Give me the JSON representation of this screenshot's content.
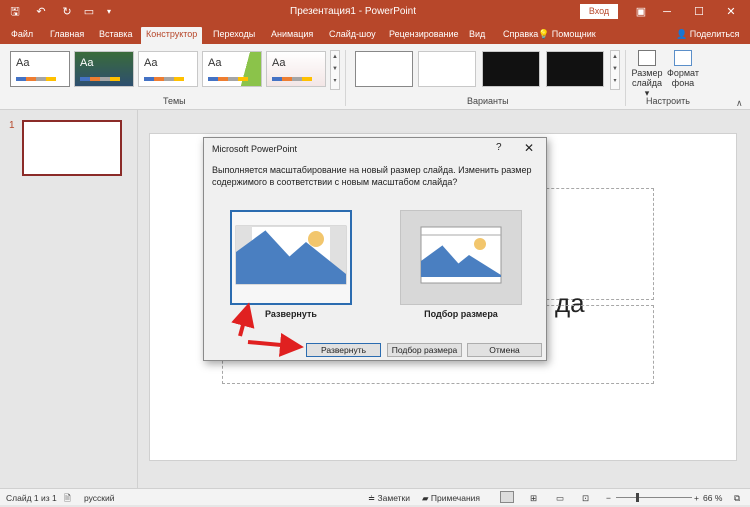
{
  "app": {
    "title": "Презентация1  -  PowerPoint",
    "login": "Вход"
  },
  "quick_access": {
    "save_icon": "save-icon",
    "undo_icon": "undo-icon",
    "redo_icon": "redo-icon",
    "present_icon": "present-from-start-icon"
  },
  "tabs": [
    "Файл",
    "Главная",
    "Вставка",
    "Конструктор",
    "Переходы",
    "Анимация",
    "Слайд-шоу",
    "Рецензирование",
    "Вид",
    "Справка"
  ],
  "active_tab": "Конструктор",
  "help": {
    "label": "Помощник"
  },
  "share": {
    "label": "Поделиться"
  },
  "ribbon": {
    "themes_label": "Темы",
    "variants_label": "Варианты",
    "customize_label": "Настроить",
    "theme_sample": "Aa",
    "slide_size": "Размер слайда",
    "slide_size_line1": "Размер",
    "slide_size_line2": "слайда ▾",
    "format_bg_line1": "Формат",
    "format_bg_line2": "фона"
  },
  "thumbnails": {
    "number": "1"
  },
  "slide": {
    "title_fragment": "да"
  },
  "dialog": {
    "title": "Microsoft PowerPoint",
    "help": "?",
    "close": "✕",
    "message": "Выполняется масштабирование на новый размер слайда. Изменить размер содержимого в соответствии с новым масштабом слайда?",
    "option_maximize": "Развернуть",
    "option_fit": "Подбор размера",
    "btn_maximize": "Развернуть",
    "btn_fit": "Подбор размера",
    "btn_cancel": "Отмена"
  },
  "status": {
    "slide_info": "Слайд 1 из 1",
    "language": "русский",
    "notes": "Заметки",
    "comments": "Примечания",
    "zoom": "66 %"
  },
  "colors": {
    "accent": "#b7472a",
    "dialog_selected": "#2b6cb0",
    "arrow": "#e02020"
  }
}
